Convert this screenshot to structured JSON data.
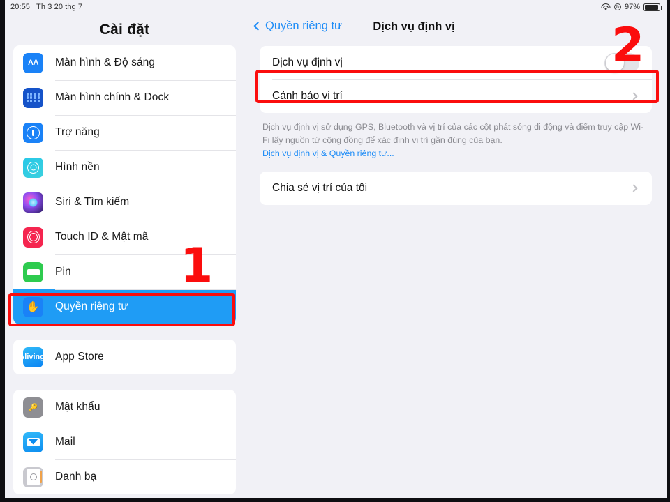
{
  "status_bar": {
    "time": "20:55",
    "date": "Th 3 20 thg 7",
    "battery_percent": "97%",
    "wifi_icon": "wifi-icon",
    "orientation_lock_icon": "rotation-lock-icon",
    "battery_icon": "battery-icon"
  },
  "sidebar": {
    "title": "Cài đặt",
    "groups": [
      {
        "items": [
          {
            "label": "Màn hình & Độ sáng",
            "icon": "display-brightness-icon",
            "selected": false
          },
          {
            "label": "Màn hình chính & Dock",
            "icon": "home-screen-dock-icon",
            "selected": false
          },
          {
            "label": "Trợ năng",
            "icon": "accessibility-icon",
            "selected": false
          },
          {
            "label": "Hình nền",
            "icon": "wallpaper-icon",
            "selected": false
          },
          {
            "label": "Siri & Tìm kiếm",
            "icon": "siri-icon",
            "selected": false
          },
          {
            "label": "Touch ID & Mật mã",
            "icon": "touch-id-icon",
            "selected": false
          },
          {
            "label": "Pin",
            "icon": "battery-settings-icon",
            "selected": false
          },
          {
            "label": "Quyền riêng tư",
            "icon": "privacy-hand-icon",
            "selected": true
          }
        ]
      },
      {
        "items": [
          {
            "label": "App Store",
            "icon": "app-store-icon",
            "selected": false
          }
        ]
      },
      {
        "items": [
          {
            "label": "Mật khẩu",
            "icon": "passwords-key-icon",
            "selected": false
          },
          {
            "label": "Mail",
            "icon": "mail-icon",
            "selected": false
          },
          {
            "label": "Danh bạ",
            "icon": "contacts-icon",
            "selected": false
          }
        ]
      }
    ]
  },
  "detail": {
    "back_label": "Quyền riêng tư",
    "back_icon": "chevron-left-icon",
    "title": "Dịch vụ định vị",
    "rows_top": [
      {
        "label": "Dịch vụ định vị",
        "control": "toggle",
        "toggle_on": false
      },
      {
        "label": "Cảnh báo vị trí",
        "control": "chevron",
        "chevron_icon": "chevron-right-icon"
      }
    ],
    "footnote": "Dịch vụ định vị sử dụng GPS, Bluetooth và vị trí của các cột phát sóng di động và điểm truy cập Wi-Fi lấy nguồn từ cộng đồng để xác định vị trí gần đúng của bạn.",
    "footnote_link": "Dịch vụ định vị & Quyền riêng tư...",
    "rows_bottom": [
      {
        "label": "Chia sẻ vị trí của tôi",
        "control": "chevron",
        "chevron_icon": "chevron-right-icon"
      }
    ]
  },
  "annotations": {
    "step_one": "1",
    "step_two": "2",
    "highlight_color": "#fb0d0d",
    "selected_row_color": "#1f9cf5"
  }
}
